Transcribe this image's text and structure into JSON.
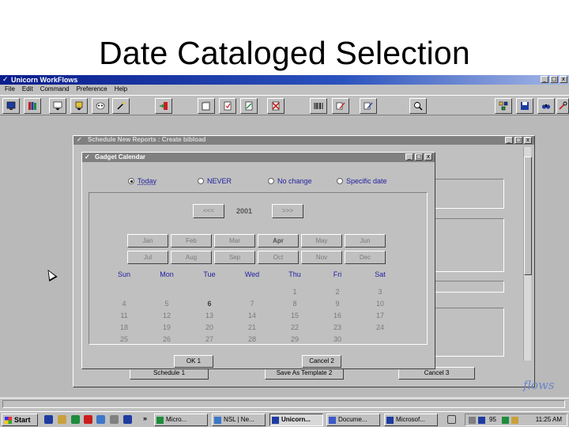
{
  "slide": {
    "title": "Date Cataloged Selection"
  },
  "app": {
    "title": "Unicorn WorkFlows",
    "menu": [
      "File",
      "Edit",
      "Command",
      "Preference",
      "Help"
    ],
    "window_controls": [
      "_",
      "□",
      "x"
    ]
  },
  "toolbar": {
    "icons": [
      "monitor-icon",
      "books-icon",
      "chevron-down-icon",
      "book-down-icon",
      "mask-icon",
      "wand-icon",
      "exit-icon",
      "window-icon",
      "document-icon",
      "check-doc-icon",
      "cancel-icon",
      "barcode-icon",
      "pen-icon",
      "edit-icon",
      "search-icon",
      "network-icon",
      "save-icon",
      "binoculars-icon",
      "tools-icon"
    ],
    "colors": {
      "red": "#c81e1e",
      "yellow": "#e6c23c",
      "blue": "#1e3ca0",
      "green": "#1e8c3c"
    }
  },
  "schedule_window": {
    "title": "Schedule New Reports : Create bibload",
    "buttons": [
      "Schedule 1",
      "Save As Template 2",
      "Cancel 3"
    ]
  },
  "calendar": {
    "title": "Gadget Calendar",
    "options": [
      {
        "label": "Today",
        "selected": true
      },
      {
        "label": "NEVER",
        "selected": false
      },
      {
        "label": "No change",
        "selected": false
      },
      {
        "label": "Specific date",
        "selected": false
      }
    ],
    "prev_label": "<<<",
    "next_label": ">>>",
    "year": "2001",
    "months": [
      "Jan",
      "Feb",
      "Mar",
      "Apr",
      "May",
      "Jun",
      "Jul",
      "Aug",
      "Sep",
      "Oct",
      "Nov",
      "Dec"
    ],
    "selected_month": "Apr",
    "weekdays": [
      "Sun",
      "Mon",
      "Tue",
      "Wed",
      "Thu",
      "Fri",
      "Sat"
    ],
    "days": [
      [
        "",
        "",
        "",
        "",
        "1",
        "2",
        "3"
      ],
      [
        "4",
        "5",
        "6",
        "7",
        "8",
        "9",
        "10"
      ],
      [
        "11",
        "12",
        "13",
        "14",
        "15",
        "16",
        "17"
      ],
      [
        "18",
        "19",
        "20",
        "21",
        "22",
        "23",
        "24"
      ],
      [
        "25",
        "26",
        "27",
        "28",
        "29",
        "30",
        ""
      ]
    ],
    "selected_day": "6",
    "ok_label": "OK 1",
    "cancel_label": "Cancel 2"
  },
  "watermark": "flows",
  "taskbar": {
    "start_label": "Start",
    "tasks": [
      "Micro...",
      "NSL | Ne...",
      "Unicorn...",
      "Docume...",
      "Microsof..."
    ],
    "active_task": "Unicorn...",
    "clock": "11:25 AM",
    "tray_number": "95"
  }
}
